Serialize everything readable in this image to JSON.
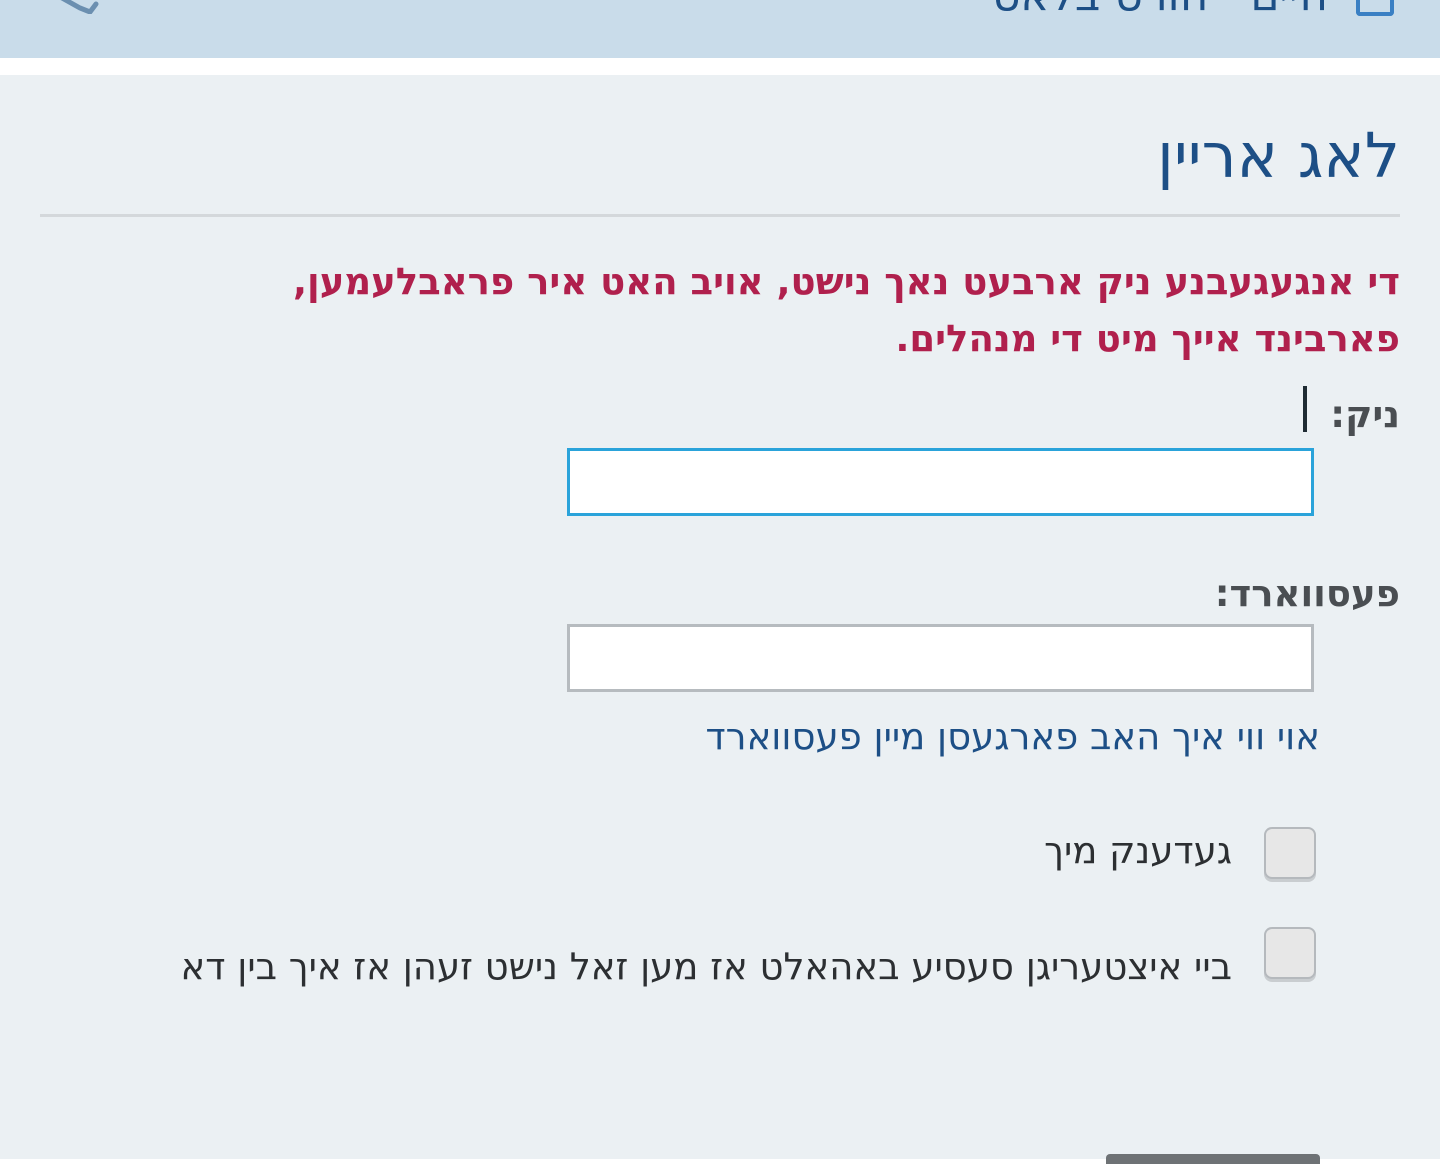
{
  "header": {
    "title": "היים · הורט בלאט",
    "page_icon": "document-icon",
    "tool_icon": "wrench-icon"
  },
  "login": {
    "title": "לאג אריין",
    "error_message": "די אנגעגעבנע ניק ארבעט נאך נישט, אויב האט איר פראבלעמען, פארבינד אייך מיט די מנהלים.",
    "nick_label": "ניק:",
    "nick_value": "",
    "password_label": "פעסווארד:",
    "password_value": "",
    "forgot_password_link": "אוי ווי איך האב פארגעסן מיין פעסווארד",
    "remember_me_label": "געדענק מיך",
    "remember_me_checked": false,
    "shared_device_label": "ביי איצטעריגן סעסיע באהאלט אז מען זאל נישט זעהן אז איך בין דא",
    "shared_device_checked": false
  },
  "colors": {
    "header_bg": "#c9dcea",
    "panel_bg": "#ebf0f3",
    "title_blue": "#1d4f86",
    "error_red": "#b0204d",
    "focus_border": "#2aa3da"
  }
}
